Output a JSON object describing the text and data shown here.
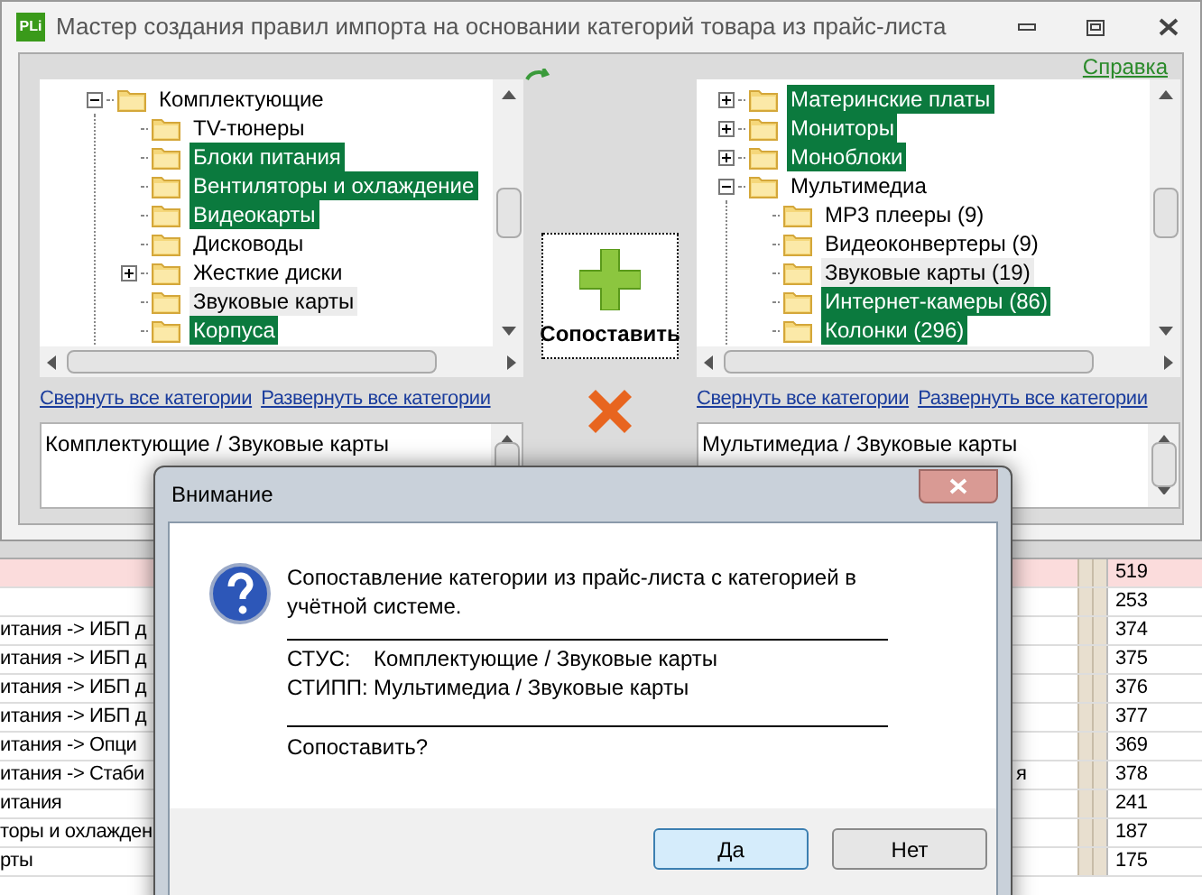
{
  "window": {
    "app_icon": "PLi",
    "title": "Мастер создания правил импорта на основании категорий товара из прайс-листа",
    "help_link": "Справка"
  },
  "left_panel": {
    "tree": [
      {
        "label": "Комплектующие",
        "expanded": true,
        "mapped": false,
        "selected": false,
        "children": [
          {
            "label": "TV-тюнеры",
            "mapped": false,
            "selected": false
          },
          {
            "label": "Блоки питания",
            "mapped": true,
            "selected": false
          },
          {
            "label": "Вентиляторы и охлаждение",
            "mapped": true,
            "selected": false
          },
          {
            "label": "Видеокарты",
            "mapped": true,
            "selected": false
          },
          {
            "label": "Дисководы",
            "mapped": false,
            "selected": false
          },
          {
            "label": "Жесткие диски",
            "expanded": false,
            "mapped": false,
            "selected": false
          },
          {
            "label": "Звуковые карты",
            "mapped": false,
            "selected": true
          },
          {
            "label": "Корпуса",
            "mapped": true,
            "selected": false
          }
        ]
      }
    ],
    "collapse_link": "Свернуть все категории",
    "expand_link": "Развернуть все категории",
    "path": "Комплектующие / Звуковые карты"
  },
  "match_button": "Сопоставить",
  "right_panel": {
    "tree": [
      {
        "label": "Материнские платы",
        "expanded": false,
        "mapped": true,
        "selected": false
      },
      {
        "label": "Мониторы",
        "expanded": false,
        "mapped": true,
        "selected": false
      },
      {
        "label": "Моноблоки",
        "expanded": false,
        "mapped": true,
        "selected": false
      },
      {
        "label": "Мультимедиа",
        "expanded": true,
        "mapped": false,
        "selected": false,
        "children": [
          {
            "label": "MP3 плееры (9)",
            "mapped": false,
            "selected": false
          },
          {
            "label": "Видеоконвертеры (9)",
            "mapped": false,
            "selected": false
          },
          {
            "label": "Звуковые карты (19)",
            "mapped": false,
            "selected": true
          },
          {
            "label": "Интернет-камеры (86)",
            "mapped": true,
            "selected": false
          },
          {
            "label": "Колонки (296)",
            "mapped": true,
            "selected": false
          }
        ]
      }
    ],
    "collapse_link": "Свернуть все категории",
    "expand_link": "Развернуть все категории",
    "path": "Мультимедиа / Звуковые карты"
  },
  "table": {
    "rows": [
      {
        "number": "519",
        "highlighted": true
      },
      {
        "number": "253",
        "highlighted": false
      },
      {
        "name": "итания -> ИБП д",
        "number": "374",
        "highlighted": false
      },
      {
        "name": "итания -> ИБП д",
        "number": "375",
        "highlighted": false
      },
      {
        "name": "итания -> ИБП д",
        "number": "376",
        "highlighted": false
      },
      {
        "name": "итания -> ИБП д",
        "number": "377",
        "highlighted": false
      },
      {
        "name": "итания -> Опци",
        "number": "369",
        "highlighted": false
      },
      {
        "name": "итания -> Стаби",
        "extra": "я",
        "number": "378",
        "highlighted": false
      },
      {
        "name": "итания",
        "number": "241",
        "highlighted": false
      },
      {
        "name": "торы и охлажден",
        "number": "187",
        "highlighted": false
      },
      {
        "name": "рты",
        "number": "175",
        "highlighted": false
      }
    ]
  },
  "dialog": {
    "title": "Внимание",
    "message": "Сопоставление категории из прайс-листа с категорией в учётной системе.",
    "lines": [
      {
        "label": "СТУС:",
        "value": "Комплектующие / Звуковые карты"
      },
      {
        "label": "СТИПП:",
        "value": "Мультимедиа / Звуковые карты"
      }
    ],
    "question": "Сопоставить?",
    "buttons": [
      {
        "label": "Да",
        "default": true
      },
      {
        "label": "Нет",
        "default": false
      }
    ]
  }
}
